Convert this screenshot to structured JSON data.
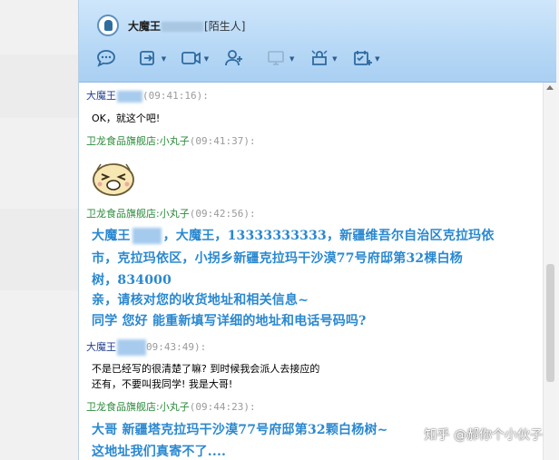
{
  "window": {
    "contact_name": "大魔王",
    "contact_tag": "[陌生人]"
  },
  "toolbar": {
    "items": [
      {
        "icon": "chat-bubble-icon",
        "dropdown": false
      },
      {
        "icon": "file-transfer-icon",
        "dropdown": true
      },
      {
        "icon": "video-call-icon",
        "dropdown": true
      },
      {
        "icon": "add-contact-icon",
        "dropdown": false
      },
      {
        "icon": "remote-desktop-icon",
        "dropdown": true,
        "disabled": true
      },
      {
        "icon": "app-box-icon",
        "dropdown": true
      },
      {
        "icon": "schedule-icon",
        "dropdown": true
      }
    ]
  },
  "messages": [
    {
      "sender": "大魔王",
      "time": "(09:41:16):",
      "text": "OK，就这个吧!"
    },
    {
      "sender": "卫龙食品旗舰店:小丸子",
      "time": "(09:41:37):",
      "sticker": "laughing-face-sticker"
    },
    {
      "sender": "卫龙食品旗舰店:小丸子",
      "time": "(09:42:56):",
      "lines": [
        {
          "prefix": "大魔王",
          "rest": "，大魔王，13333333333，新疆维吾尔自治区克拉玛依"
        },
        {
          "text": "市，克拉玛依区，小拐乡新疆克拉玛干沙漠77号府邸第32棵白杨"
        },
        {
          "text": "树，834000"
        },
        {
          "text": "亲，请核对您的收货地址和相关信息~"
        },
        {
          "text": "同学   您好    能重新填写详细的地址和电话号码吗?"
        }
      ]
    },
    {
      "sender": "大魔王",
      "time": "09:43:49):",
      "lines": [
        {
          "text": "不是已经写的很清楚了嘛? 到时候我会派人去接应的"
        },
        {
          "text": "还有，不要叫我同学! 我是大哥!"
        }
      ]
    },
    {
      "sender": "卫龙食品旗舰店:小丸子",
      "time": "(09:44:23):",
      "lines": [
        {
          "text": "大哥      新疆塔克拉玛干沙漠77号府邸第32颗白杨树~"
        },
        {
          "text": "这地址我们真寄不了...."
        }
      ]
    }
  ],
  "watermark": "知乎 @郝你个小伙子"
}
